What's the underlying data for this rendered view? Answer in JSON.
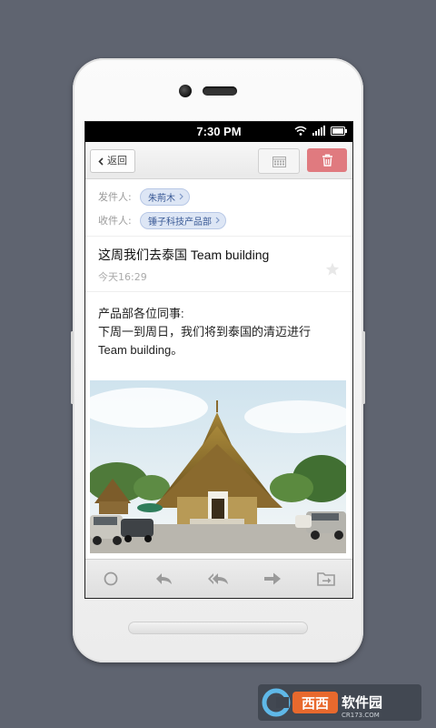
{
  "status_bar": {
    "time": "7:30 PM"
  },
  "toolbar": {
    "back_label": "返回"
  },
  "email": {
    "sender_label": "发件人:",
    "sender": "朱荊木",
    "recipient_label": "收件人:",
    "recipient": "锤子科技产品部",
    "subject": "这周我们去泰国 Team building",
    "date": "今天16:29",
    "body_line1": "产品部各位同事:",
    "body_line2": "下周一到周日，我们将到泰国的清迈进行",
    "body_line3": "Team building。"
  },
  "bottom_bar": {
    "icons": [
      "circle-icon",
      "reply-icon",
      "reply-all-icon",
      "forward-icon",
      "move-to-folder-icon"
    ]
  },
  "watermark": {
    "brand": "西西软件园",
    "site": "CR173.COM"
  },
  "colors": {
    "delete_red": "#e07a7f",
    "chip_blue": "#dde6f5",
    "backdrop": "#5f6470"
  }
}
